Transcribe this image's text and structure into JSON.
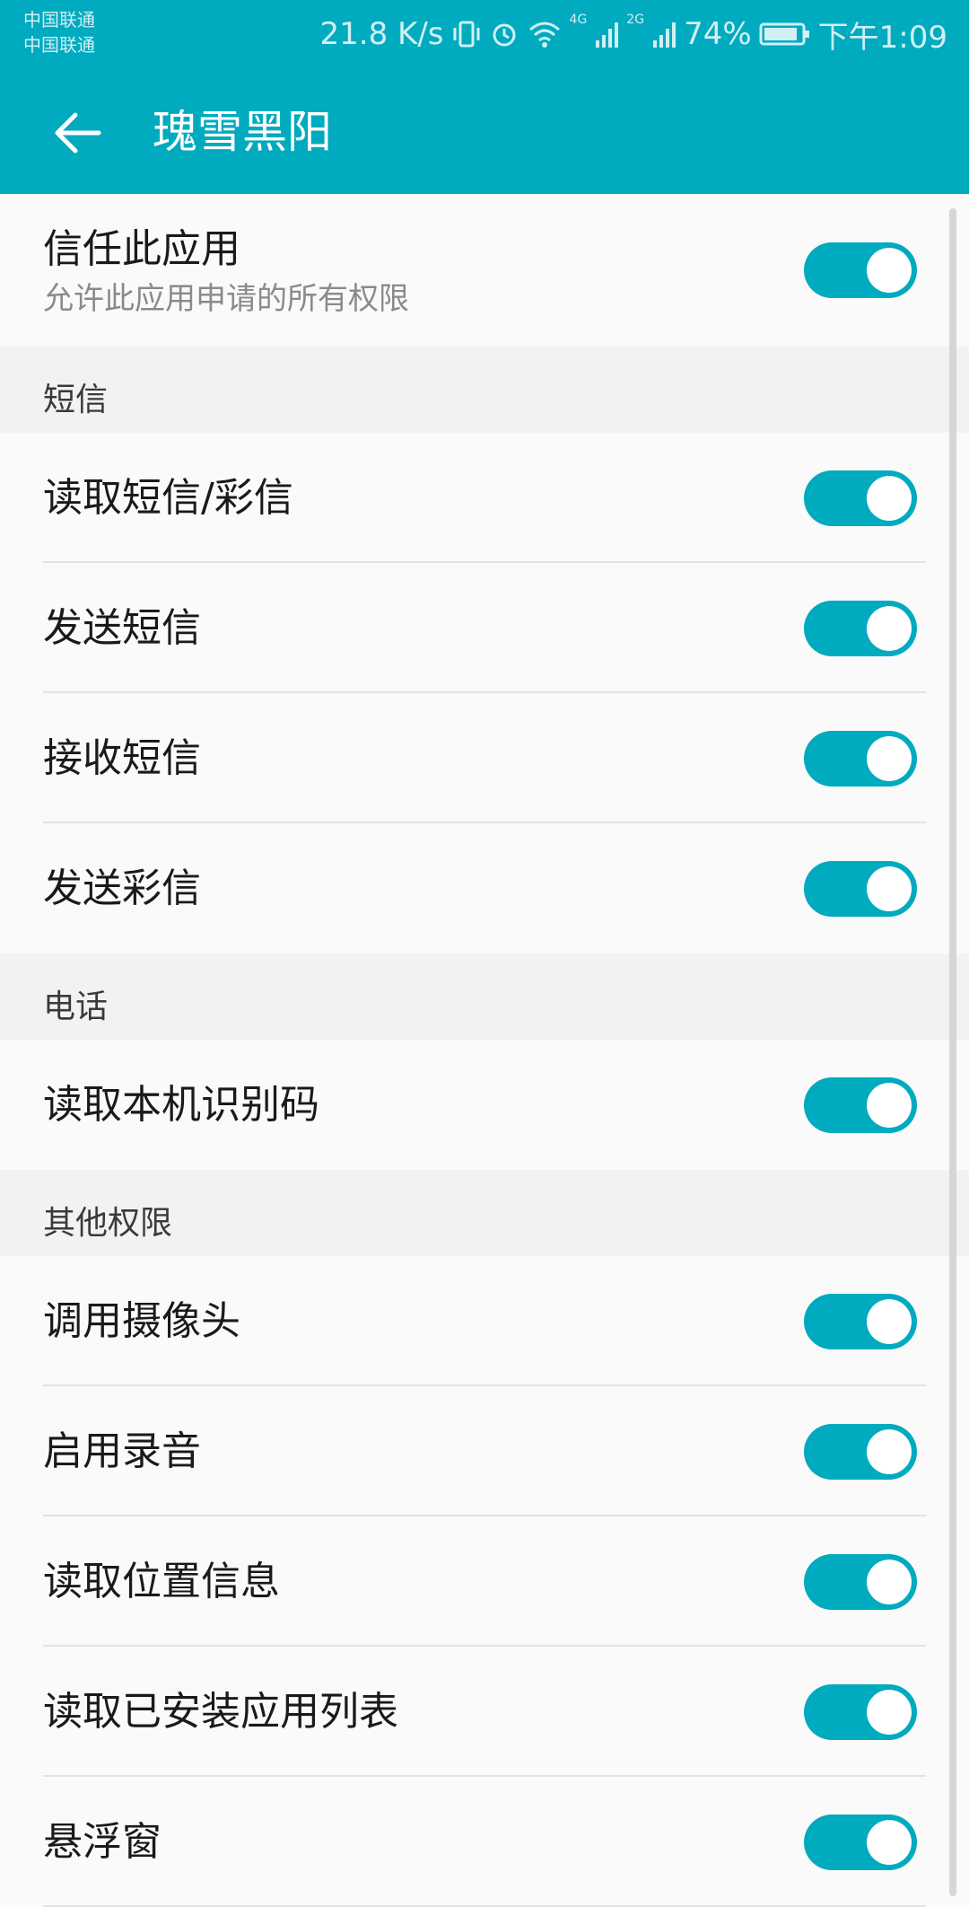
{
  "status_bar": {
    "carrier1": "中国联通",
    "carrier2": "中国联通",
    "net_speed": "21.8 K/s",
    "sim1_type": "4G",
    "sim2_type": "2G",
    "battery": "74%",
    "time": "下午1:09",
    "icons": [
      "vibrate-icon",
      "alarm-icon",
      "wifi-icon",
      "signal-icon",
      "battery-icon"
    ]
  },
  "toolbar": {
    "title": "瑰雪黑阳",
    "back_icon": "back-arrow-icon"
  },
  "trust": {
    "label": "信任此应用",
    "sub": "允许此应用申请的所有权限",
    "enabled": true
  },
  "sections": [
    {
      "header": "短信",
      "items": [
        {
          "label": "读取短信/彩信",
          "enabled": true
        },
        {
          "label": "发送短信",
          "enabled": true
        },
        {
          "label": "接收短信",
          "enabled": true
        },
        {
          "label": "发送彩信",
          "enabled": true
        }
      ]
    },
    {
      "header": "电话",
      "items": [
        {
          "label": "读取本机识别码",
          "enabled": true
        }
      ]
    },
    {
      "header": "其他权限",
      "items": [
        {
          "label": "调用摄像头",
          "enabled": true
        },
        {
          "label": "启用录音",
          "enabled": true
        },
        {
          "label": "读取位置信息",
          "enabled": true
        },
        {
          "label": "读取已安装应用列表",
          "enabled": true
        },
        {
          "label": "悬浮窗",
          "enabled": true
        }
      ]
    }
  ],
  "colors": {
    "accent": "#00aabf",
    "background": "#fafafa",
    "section_bg": "#f2f2f2"
  }
}
